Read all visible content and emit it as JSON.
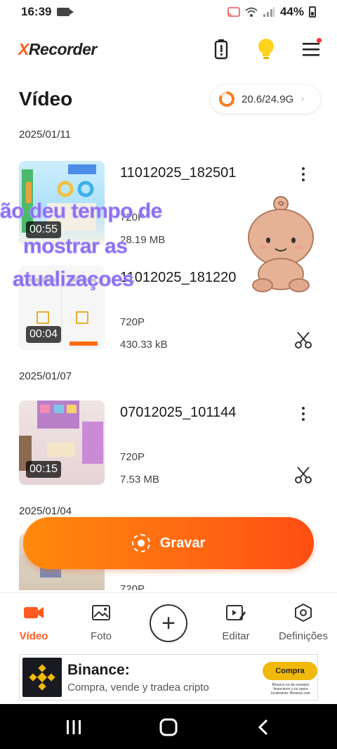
{
  "status_bar": {
    "time": "16:39",
    "battery": "44%"
  },
  "header": {
    "logo_prefix": "X",
    "logo_rest": "Recorder"
  },
  "page": {
    "title": "Vídeo"
  },
  "storage": {
    "text": "20.6/24.9G",
    "used_fraction": 0.83
  },
  "groups": [
    {
      "date": "2025/01/11"
    },
    {
      "date": "2025/01/07"
    },
    {
      "date": "2025/01/04"
    }
  ],
  "videos": [
    {
      "name": "11012025_182501",
      "duration": "00:55",
      "resolution": "720P",
      "size": "28.19 MB"
    },
    {
      "name": "11012025_181220",
      "duration": "00:04",
      "resolution": "720P",
      "size": "430.33 kB"
    },
    {
      "name": "07012025_101144",
      "duration": "00:15",
      "resolution": "720P",
      "size": "7.53 MB"
    },
    {
      "resolution": "720P"
    }
  ],
  "overlay": {
    "line1": "ão  deu tempo de",
    "line2": "mostrar as",
    "line3": "atualizaçoes"
  },
  "record_button": {
    "label": "Gravar"
  },
  "bottom_nav": [
    {
      "label": "Vídeo",
      "icon": "video-camera-icon",
      "active": true
    },
    {
      "label": "Foto",
      "icon": "image-icon",
      "active": false
    },
    {
      "label": "Editar",
      "icon": "edit-video-icon",
      "active": false
    },
    {
      "label": "Definições",
      "icon": "settings-hexagon-icon",
      "active": false
    }
  ],
  "ad": {
    "title": "Binance:",
    "description": "Compra, vende y tradea cripto",
    "cta": "Compra",
    "fine_print": "Binance no da consejos financieros y no opera localmente: Binance.com"
  },
  "colors": {
    "accent": "#ff5a1f",
    "record_gradient_start": "#ff8a0c",
    "record_gradient_end": "#ff4e14",
    "binance_yellow": "#f0b90b",
    "overlay_text": "#8a6cf0"
  }
}
